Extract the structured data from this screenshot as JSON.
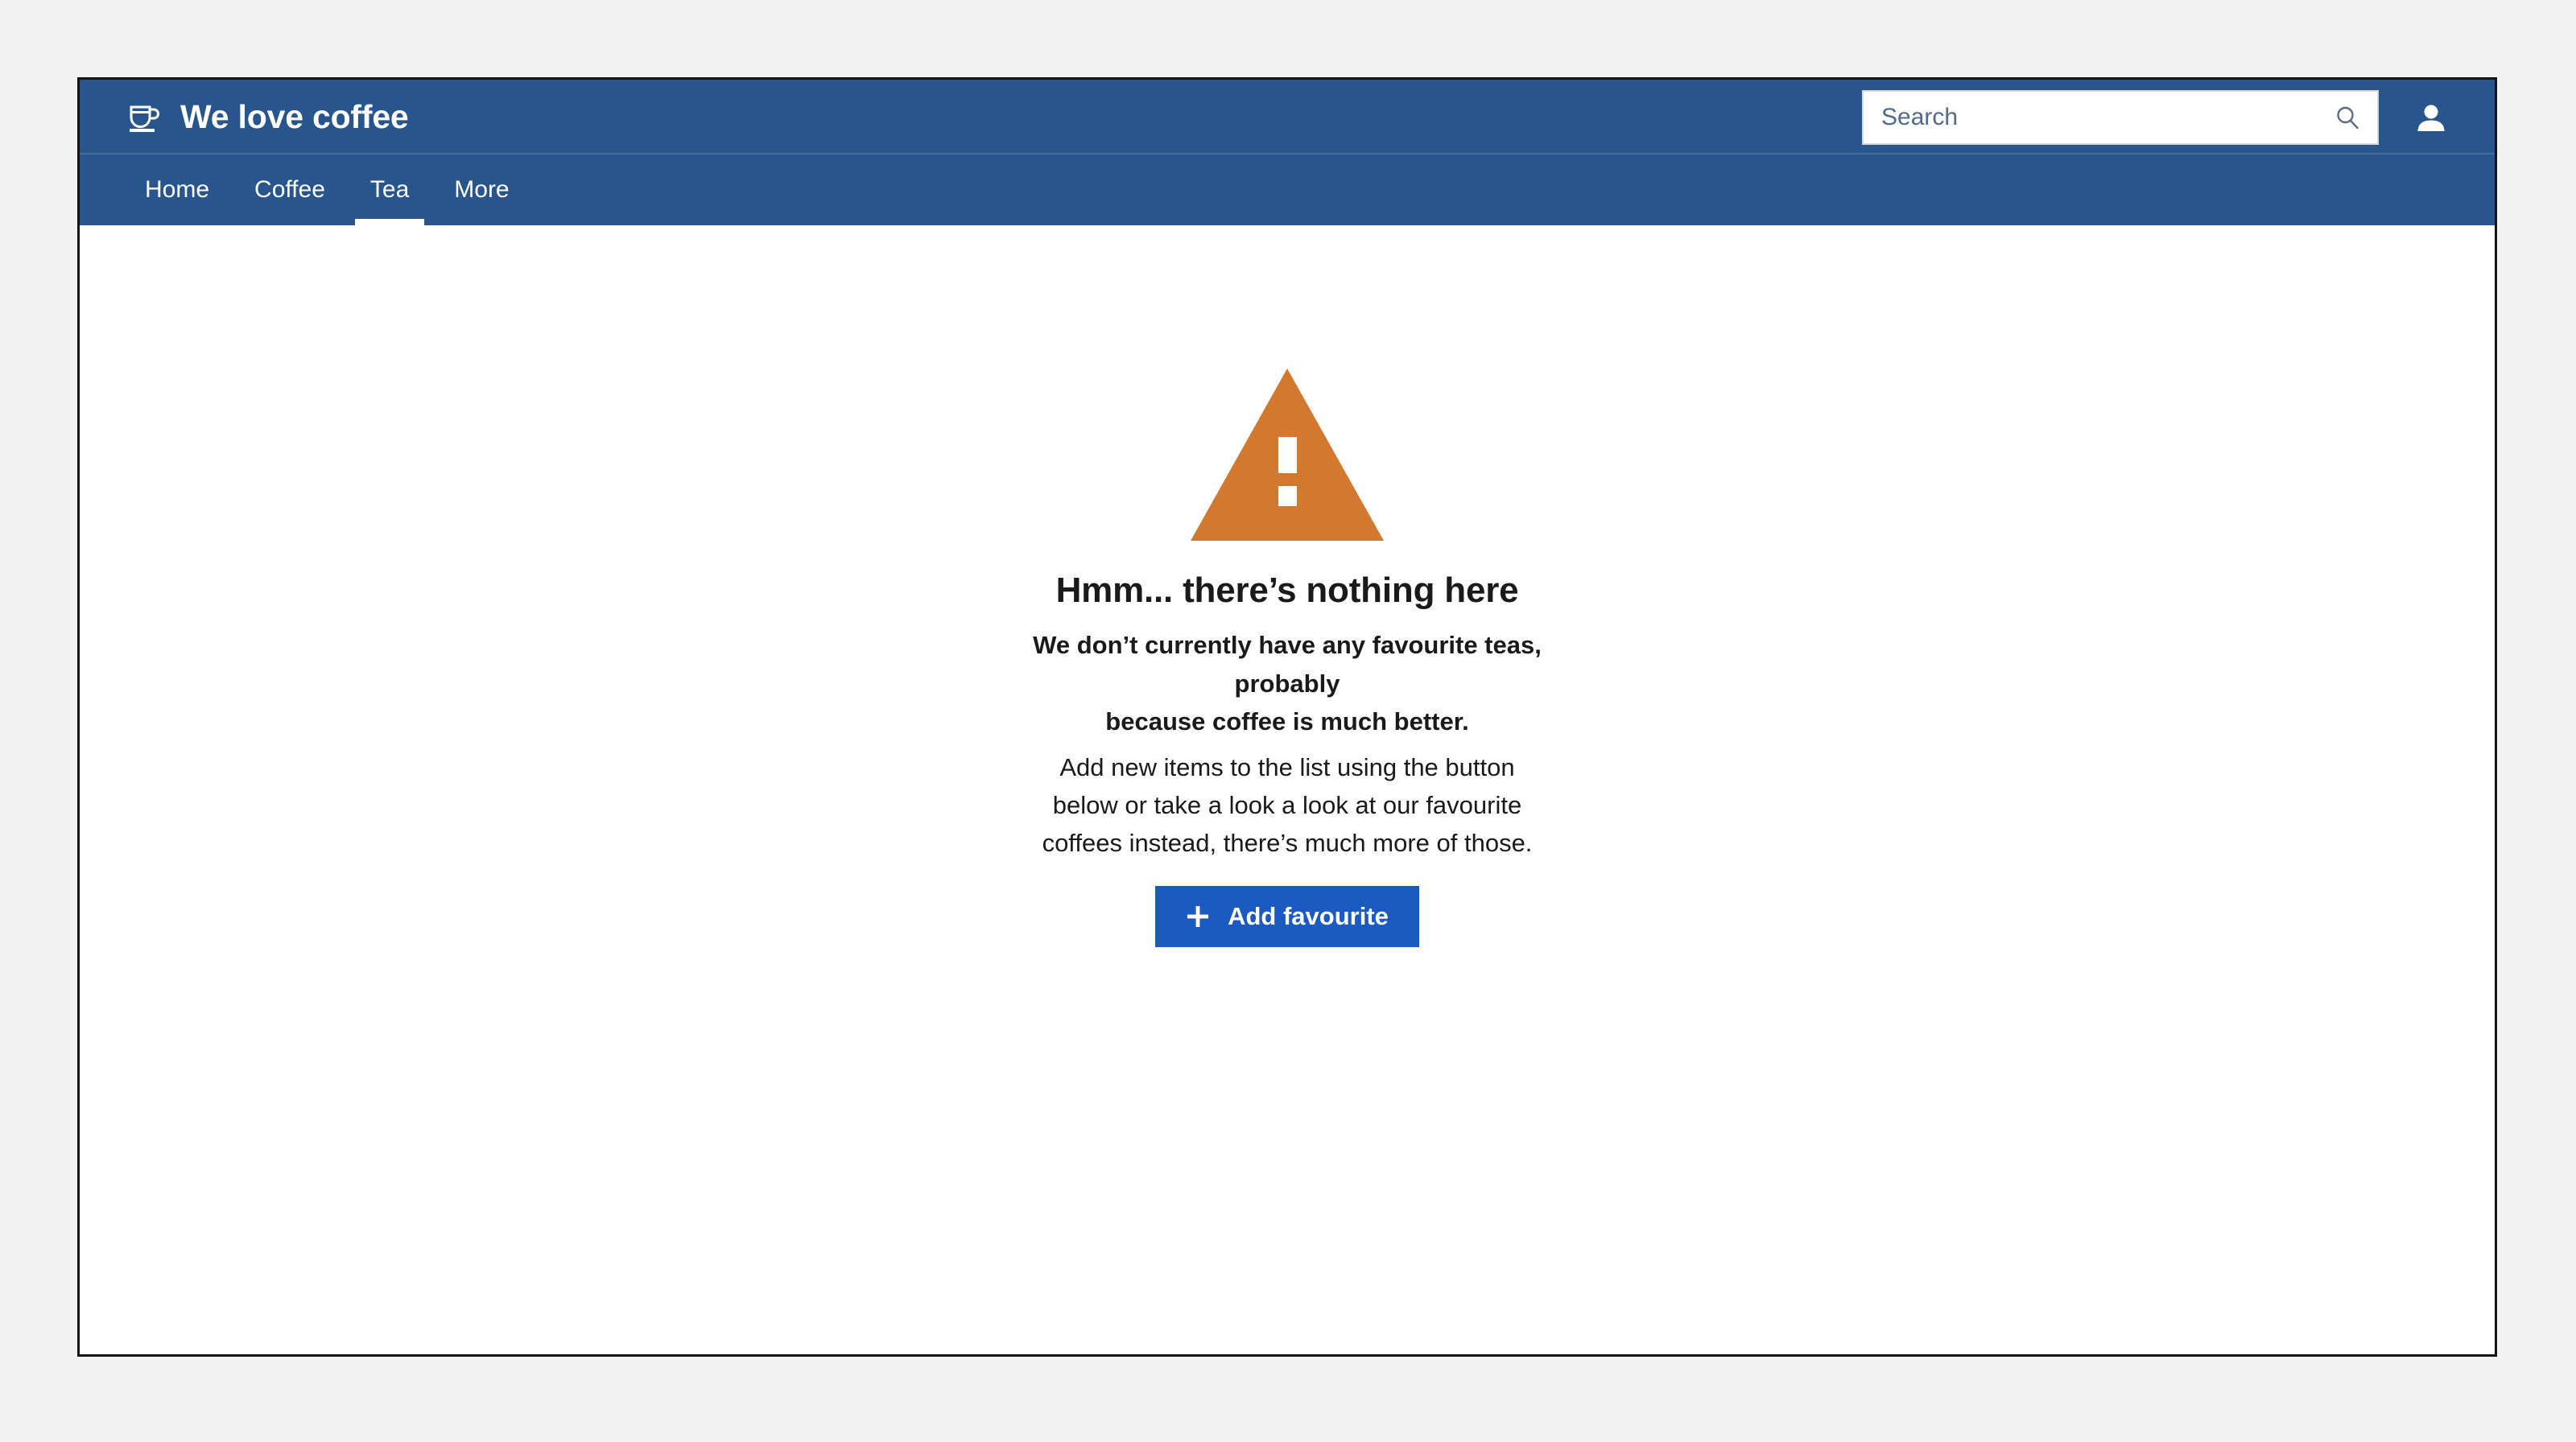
{
  "brand": {
    "title": "We love coffee",
    "logo_icon": "coffee-cup-icon"
  },
  "header": {
    "search": {
      "placeholder": "Search",
      "value": "",
      "icon": "search-icon"
    },
    "account": {
      "icon": "account-person-icon"
    }
  },
  "nav": {
    "items": [
      {
        "label": "Home",
        "active": false
      },
      {
        "label": "Coffee",
        "active": false
      },
      {
        "label": "Tea",
        "active": true
      },
      {
        "label": "More",
        "active": false
      }
    ]
  },
  "empty_state": {
    "icon": "warning-triangle-icon",
    "title": "Hmm... there’s nothing here",
    "bold_line_1": "We don’t currently have any favourite teas, probably",
    "bold_line_2": "because coffee is much better.",
    "text_line_1": "Add new items to the list using the button",
    "text_line_2": "below or take a look a look at our favourite",
    "text_line_3": "coffees instead, there’s much more of those.",
    "button": {
      "label": "Add favourite",
      "icon": "plus-icon"
    }
  },
  "colors": {
    "header_blue": "#27558C",
    "button_blue": "#1B5AC0",
    "warning_orange": "#D2782F",
    "page_background": "#F2F2F2",
    "card_background": "#FFFFFF",
    "card_border": "#141414",
    "text_primary": "#1A1A1A",
    "placeholder_text": "#53698A"
  }
}
